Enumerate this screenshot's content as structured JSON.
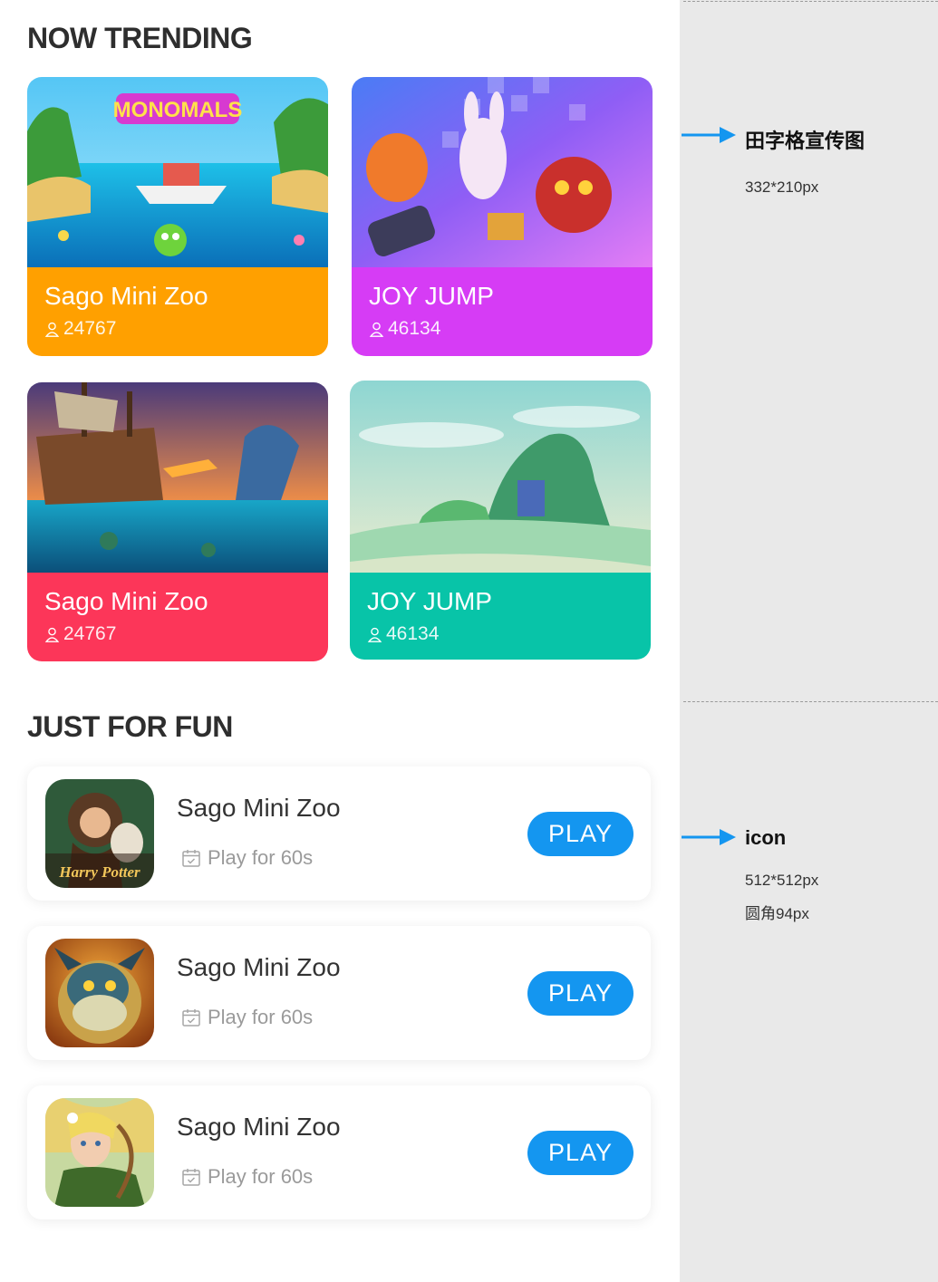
{
  "trending": {
    "heading": "NOW TRENDING",
    "cards": [
      {
        "title": "Sago Mini Zoo",
        "players": "24767",
        "color": "#ffa000",
        "art_logo": "MONOMALS"
      },
      {
        "title": "JOY JUMP",
        "players": "46134",
        "color": "#d63cf5"
      },
      {
        "title": "Sago Mini Zoo",
        "players": "24767",
        "color": "#fc3659"
      },
      {
        "title": "JOY JUMP",
        "players": "46134",
        "color": "#08c4a8"
      }
    ]
  },
  "fun": {
    "heading": "JUST FOR FUN",
    "items": [
      {
        "name": "Sago Mini Zoo",
        "meta": "Play for 60s",
        "button": "PLAY",
        "icon_text": "Harry Potter",
        "icon": "harry-potter-icon"
      },
      {
        "name": "Sago Mini Zoo",
        "meta": "Play for 60s",
        "button": "PLAY",
        "icon": "dragon-hero-icon"
      },
      {
        "name": "Sago Mini Zoo",
        "meta": "Play for 60s",
        "button": "PLAY",
        "icon": "elf-archer-icon"
      }
    ]
  },
  "annotations": {
    "banner": {
      "title": "田字格宣传图",
      "size": "332*210px"
    },
    "icon": {
      "title": "icon",
      "size": "512*512px",
      "radius": "圆角94px"
    }
  },
  "colors": {
    "accent": "#1496f0",
    "sidebar_bg": "#e9e9e9"
  }
}
